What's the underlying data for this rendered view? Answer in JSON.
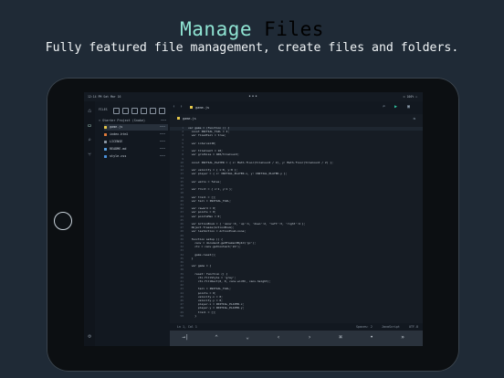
{
  "header": {
    "title_accent": "Manage",
    "title_rest": " Files",
    "subtitle": "Fully featured file management, create files and folders."
  },
  "statusbar": {
    "time": "12:14 PM   Sat Mar 16",
    "dots": "•••",
    "right": "⊙ 100% ▭"
  },
  "sidebar": {
    "toolbar_label": "FILES",
    "project": "Starter Project (Snake)",
    "project_more": "•••",
    "files": [
      {
        "name": "game.js",
        "color": "#e6c84a",
        "more": "•••"
      },
      {
        "name": "index.html",
        "color": "#e07a3a",
        "more": "•••"
      },
      {
        "name": "LICENSE",
        "color": "#8a96a3",
        "more": "•••"
      },
      {
        "name": "README.md",
        "color": "#5aa0e0",
        "more": "•••"
      },
      {
        "name": "style.css",
        "color": "#4a90d9",
        "more": "•••"
      }
    ]
  },
  "editor": {
    "tab_label": "game.js",
    "path_label": "game.js",
    "lines": [
      "var game = (function () {",
      "  const INITIAL_TAIL = 4;",
      "  var fixedTail = true;",
      "",
      "  var intervalID;",
      "",
      "  var tileCount = 10;",
      "  var gridSize = 400/tileCount;",
      "",
      "  const INITIAL_PLAYER = { x: Math.floor(tileCount / 2), y: Math.floor(tileCount / 2) };",
      "",
      "  var velocity = { x:0, y:0 };",
      "  var player = { x: INITIAL_PLAYER.x, y: INITIAL_PLAYER.y };",
      "",
      "  var walls = false;",
      "",
      "  var fruit = { x:1, y:1 };",
      "",
      "  var trail = [];",
      "  var tail = INITIAL_TAIL;",
      "",
      "  var reward = 0;",
      "  var points = 0;",
      "  var pointsMax = 0;",
      "",
      "  var ActionEnum = { 'none':0, 'up':1, 'down':2, 'left':3, 'right':4 };",
      "  Object.freeze(ActionEnum);",
      "  var lastAction = ActionEnum.none;",
      "",
      "  function setup () {",
      "    canv = document.getElementById('gc');",
      "    ctx = canv.getContext('2d');",
      "",
      "    game.reset();",
      "  }",
      "",
      "  var game = {",
      "",
      "    reset: function () {",
      "      ctx.fillStyle = 'grey';",
      "      ctx.fillRect(0, 0, canv.width, canv.height);",
      "",
      "      tail = INITIAL_TAIL;",
      "      points = 0;",
      "      velocity.x = 0;",
      "      velocity.y = 0;",
      "      player.x = INITIAL_PLAYER.x;",
      "      player.y = INITIAL_PLAYER.y;",
      "      trail = [];",
      "    }"
    ]
  },
  "statusline": {
    "position": "Ln 1, Col 1",
    "spaces": "Spaces: 2",
    "language": "JavaScript",
    "encoding": "UTF-8"
  },
  "keybar": {
    "keys": [
      "→|",
      "⌃",
      "⌄",
      "‹",
      "›",
      "⌘",
      "•",
      "»"
    ]
  }
}
